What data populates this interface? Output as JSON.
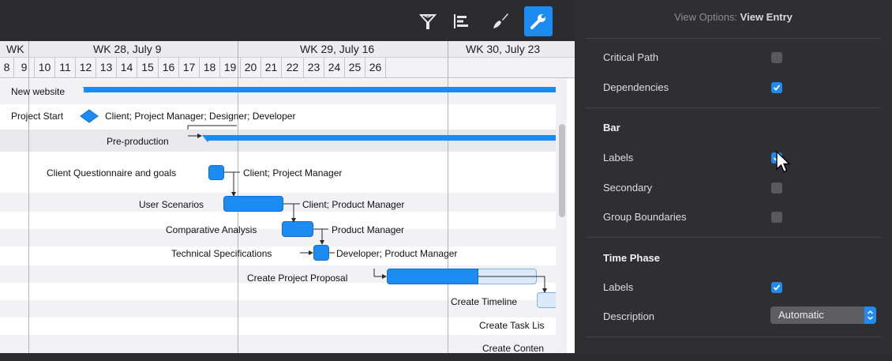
{
  "toolbar": {
    "icons": [
      "filter-icon",
      "gantt-bars-icon",
      "brush-icon",
      "wrench-icon"
    ],
    "active_icon": "wrench-icon"
  },
  "inspector": {
    "header_prefix": "View Options:",
    "header_value": "View Entry",
    "critical_path": {
      "label": "Critical Path",
      "checked": false
    },
    "dependencies": {
      "label": "Dependencies",
      "checked": true
    },
    "bar_section": "Bar",
    "bar_labels": {
      "label": "Labels",
      "checked": true
    },
    "secondary": {
      "label": "Secondary",
      "checked": false
    },
    "group_boundaries": {
      "label": "Group Boundaries",
      "checked": false
    },
    "time_phase_section": "Time Phase",
    "tp_labels": {
      "label": "Labels",
      "checked": true
    },
    "description": {
      "label": "Description",
      "value": "Automatic"
    },
    "accent": "#1f8af1"
  },
  "gantt": {
    "weeks": [
      "WK",
      "WK 28, July 9",
      "WK 29, July 16",
      "WK 30, July 23"
    ],
    "days": [
      "8",
      "9",
      "10",
      "11",
      "12",
      "13",
      "14",
      "15",
      "16",
      "17",
      "18",
      "19",
      "20",
      "21",
      "22",
      "23",
      "24",
      "25",
      "26"
    ],
    "rows": {
      "new_website": "New website",
      "project_start": "Project Start",
      "project_start_resources": "Client; Project Manager; Designer; Developer",
      "pre_production": "Pre-production",
      "client_questionnaire": "Client Questionnaire and goals",
      "client_questionnaire_res": "Client; Project Manager",
      "user_scenarios": "User Scenarios",
      "user_scenarios_res": "Client; Product Manager",
      "comparative_analysis": "Comparative Analysis",
      "comparative_analysis_res": "Product Manager",
      "tech_specs": "Technical Specifications",
      "tech_specs_res": "Developer; Product Manager",
      "create_proposal": "Create Project Proposal",
      "create_timeline": "Create Timeline",
      "create_task_list": "Create Task Lis",
      "create_content": "Create Conten"
    },
    "bar_color": "#1c8cf2"
  }
}
